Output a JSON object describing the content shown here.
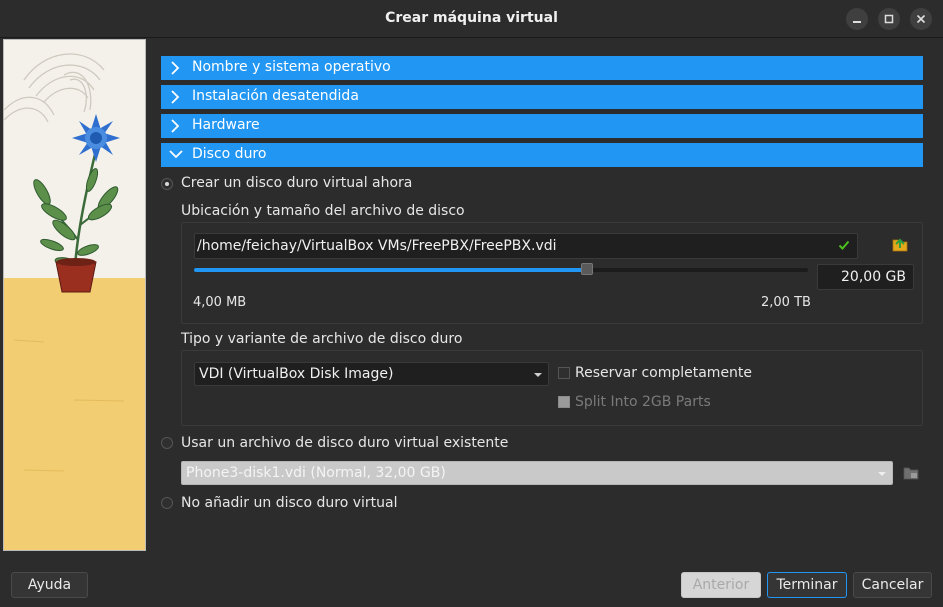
{
  "window": {
    "title": "Crear máquina virtual"
  },
  "sections": [
    {
      "label": "Nombre y sistema operativo",
      "expanded": false
    },
    {
      "label": "Instalación desatendida",
      "expanded": false
    },
    {
      "label": "Hardware",
      "expanded": false
    },
    {
      "label": "Disco duro",
      "expanded": true
    }
  ],
  "disk": {
    "option_create": "Crear un disco duro virtual ahora",
    "location_heading": "Ubicación y tamaño del archivo de disco",
    "path": "/home/feichay/VirtualBox VMs/FreePBX/FreePBX.vdi",
    "size_value": "20,00 GB",
    "size_fraction": 0.64,
    "size_min": "4,00 MB",
    "size_max": "2,00 TB",
    "type_heading": "Tipo y variante de archivo de disco duro",
    "type_selected": "VDI (VirtualBox Disk Image)",
    "preallocate_label": "Reservar completamente",
    "split_label": "Split Into 2GB Parts",
    "option_existing": "Usar un archivo de disco duro virtual existente",
    "existing_selected": "Phone3-disk1.vdi (Normal, 32,00 GB)",
    "option_none": "No añadir un disco duro virtual"
  },
  "footer": {
    "help": "Ayuda",
    "back": "Anterior",
    "finish": "Terminar",
    "cancel": "Cancelar"
  },
  "colors": {
    "accent": "#2196f3",
    "background": "#2c2c2c",
    "banner_wall": "#f4f1ea",
    "banner_table": "#f2cd72",
    "check_green": "#4cc01c"
  }
}
